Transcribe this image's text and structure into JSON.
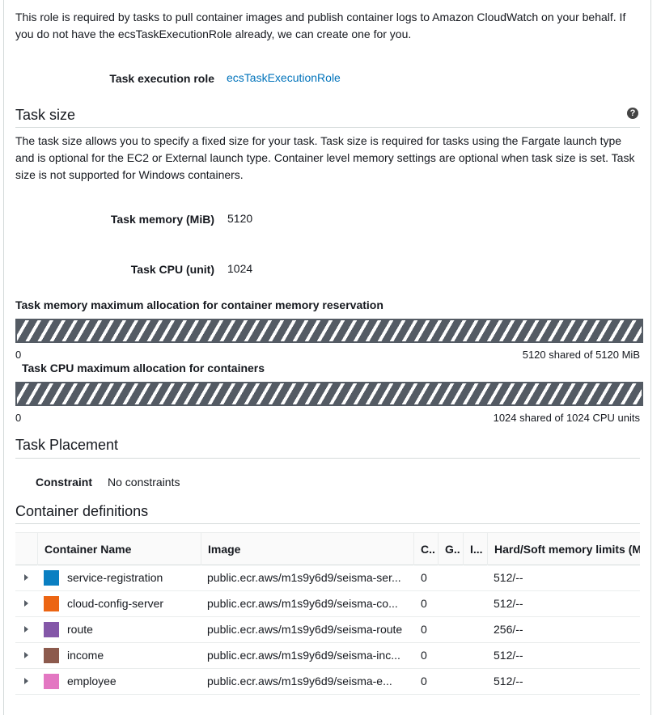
{
  "intro": {
    "line1": "This role is required by tasks to pull container images and publish container logs to Amazon CloudWatch on your behalf. If",
    "line2": "you do not have the ecsTaskExecutionRole already, we can create one for you."
  },
  "execution_role": {
    "label": "Task execution role",
    "value": "ecsTaskExecutionRole"
  },
  "task_size": {
    "heading": "Task size",
    "help_icon": "question-circle-icon",
    "desc1": "The task size allows you to specify a fixed size for your task. Task size is required for tasks using the Fargate launch type",
    "desc2": "and is optional for the EC2 or External launch type. Container level memory settings are optional when task size is set. Task",
    "desc3": "size is not supported for Windows containers.",
    "memory_label": "Task memory (MiB)",
    "memory_value": "5120",
    "cpu_label": "Task CPU (unit)",
    "cpu_value": "1024"
  },
  "memory_allocation": {
    "title": "Task memory maximum allocation for container memory reservation",
    "min": "0",
    "summary": "5120 shared of 5120 MiB",
    "fraction": 1.0
  },
  "cpu_allocation": {
    "title": "Task CPU maximum allocation for containers",
    "min": "0",
    "summary": "1024 shared of 1024 CPU units",
    "fraction": 1.0
  },
  "placement": {
    "heading": "Task Placement",
    "constraint_label": "Constraint",
    "constraint_value": "No constraints"
  },
  "containers": {
    "heading": "Container definitions",
    "columns": [
      "Container Name",
      "Image",
      "C..",
      "G..",
      "I...",
      "Hard/Soft memory limits (M"
    ],
    "rows": [
      {
        "color": "#0a7fc2",
        "name": "service-registration",
        "image": "public.ecr.aws/m1s9y6d9/seisma-ser...",
        "cpu": "0",
        "memory": "512/--"
      },
      {
        "color": "#ec6513",
        "name": "cloud-config-server",
        "image": "public.ecr.aws/m1s9y6d9/seisma-co...",
        "cpu": "0",
        "memory": "512/--"
      },
      {
        "color": "#8457a8",
        "name": "route",
        "image": "public.ecr.aws/m1s9y6d9/seisma-route",
        "cpu": "0",
        "memory": "256/--"
      },
      {
        "color": "#8c5a4d",
        "name": "income",
        "image": "public.ecr.aws/m1s9y6d9/seisma-inc...",
        "cpu": "0",
        "memory": "512/--"
      },
      {
        "color": "#e377c2",
        "name": "employee",
        "image": "public.ecr.aws/m1s9y6d9/seisma-e...",
        "cpu": "0",
        "memory": "512/--"
      }
    ]
  }
}
